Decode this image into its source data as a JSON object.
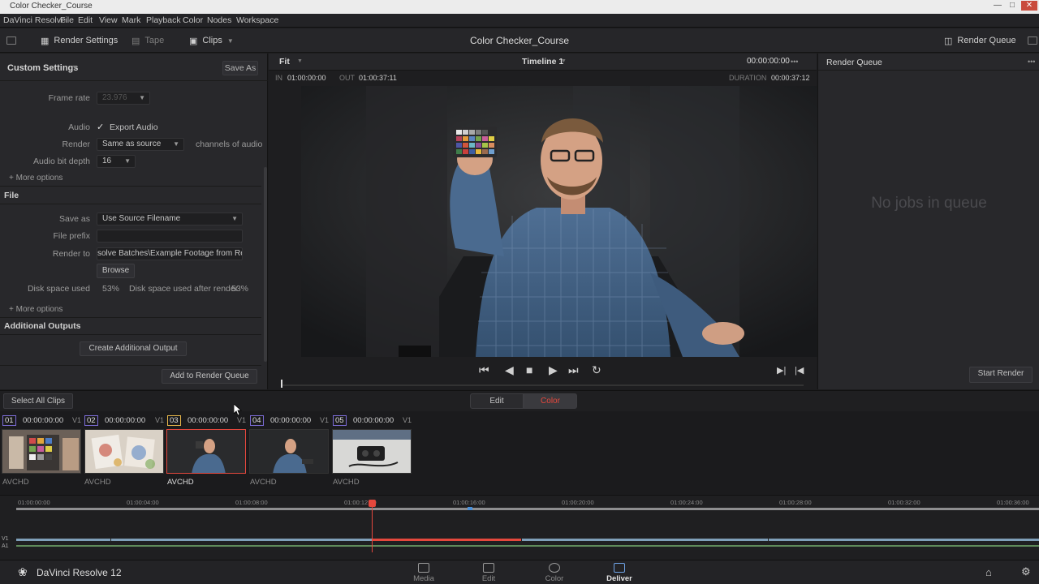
{
  "window": {
    "title": "Color Checker_Course"
  },
  "menu": [
    "DaVinci Resolve",
    "File",
    "Edit",
    "View",
    "Mark",
    "Playback",
    "Color",
    "Nodes",
    "Workspace"
  ],
  "toolbar": {
    "render_settings": "Render Settings",
    "tape": "Tape",
    "clips": "Clips",
    "project_title": "Color Checker_Course",
    "render_queue": "Render Queue"
  },
  "settings": {
    "header": "Custom Settings",
    "save_as_button": "Save As",
    "frame_rate_label": "Frame rate",
    "frame_rate_value": "23.976",
    "audio_label": "Audio",
    "export_audio": "Export Audio",
    "render_label": "Render",
    "render_value": "Same as source",
    "channels_label": "channels of audio",
    "bit_depth_label": "Audio bit depth",
    "bit_depth_value": "16",
    "more_options": "+ More options",
    "file_section": "File",
    "save_as_label": "Save as",
    "save_as_value": "Use Source Filename",
    "file_prefix_label": "File prefix",
    "render_to_label": "Render to",
    "render_to_value": "solve Batches\\Example Footage from Resolve",
    "browse": "Browse",
    "disk_used_label": "Disk space used",
    "disk_used_value": "53%",
    "disk_after_label": "Disk space used after render",
    "disk_after_value": "53%",
    "more_options_2": "+ More options",
    "additional_section": "Additional Outputs",
    "create_additional": "Create Additional Output",
    "add_to_queue": "Add to Render Queue"
  },
  "viewer": {
    "fit": "Fit",
    "timeline_name": "Timeline 1",
    "timecode": "00:00:00:00",
    "in_label": "IN",
    "in_value": "01:00:00:00",
    "out_label": "OUT",
    "out_value": "01:00:37:11",
    "duration_label": "DURATION",
    "duration_value": "00:00:37:12"
  },
  "render_queue": {
    "title": "Render Queue",
    "empty_text": "No jobs in queue",
    "start_render": "Start Render"
  },
  "clips": {
    "select_all": "Select All Clips",
    "tab_edit": "Edit",
    "tab_color": "Color",
    "items": [
      {
        "num": "01",
        "tc": "00:00:00:00",
        "track": "V1",
        "name": "AVCHD"
      },
      {
        "num": "02",
        "tc": "00:00:00:00",
        "track": "V1",
        "name": "AVCHD"
      },
      {
        "num": "03",
        "tc": "00:00:00:00",
        "track": "V1",
        "name": "AVCHD"
      },
      {
        "num": "04",
        "tc": "00:00:00:00",
        "track": "V1",
        "name": "AVCHD"
      },
      {
        "num": "05",
        "tc": "00:00:00:00",
        "track": "V1",
        "name": "AVCHD"
      }
    ]
  },
  "timeline": {
    "ticks": [
      "01:00:00:00",
      "01:00:04:00",
      "01:00:08:00",
      "01:00:12:00",
      "01:00:16:00",
      "01:00:20:00",
      "01:00:24:00",
      "01:00:28:00",
      "01:00:32:00",
      "01:00:36:00"
    ],
    "track_v": "V1",
    "track_a": "A1"
  },
  "pagebar": {
    "app_name": "DaVinci Resolve 12",
    "pages": [
      "Media",
      "Edit",
      "Color",
      "Deliver"
    ]
  },
  "colors": {
    "accent_red": "#e5483d",
    "accent_blue": "#6fa3e6",
    "tab_color_text": "#e5483d"
  }
}
